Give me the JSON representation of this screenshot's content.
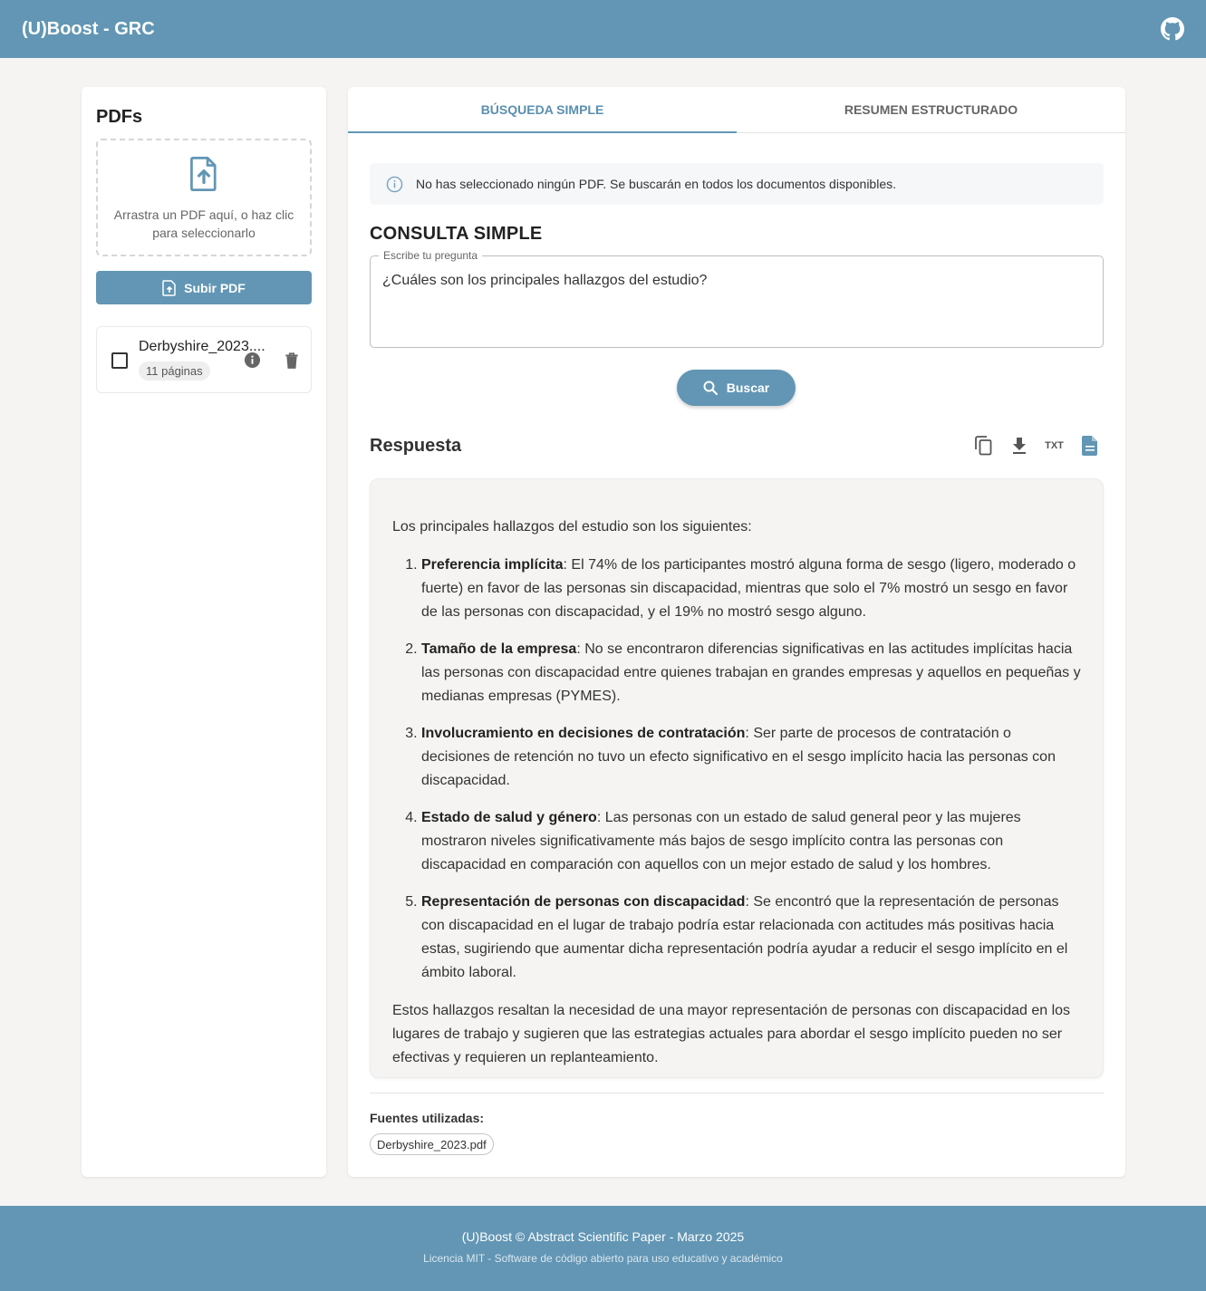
{
  "app": {
    "title": "(U)Boost - GRC",
    "github_icon": "github-icon"
  },
  "sidebar": {
    "title": "PDFs",
    "dropzone_text": "Arrastra un PDF aquí, o haz clic para seleccionarlo",
    "upload_button": "Subir PDF",
    "files": [
      {
        "name": "Derbyshire_2023....",
        "pages": "11 páginas",
        "checked": false
      }
    ]
  },
  "tabs": [
    {
      "label": "BÚSQUEDA SIMPLE",
      "active": true
    },
    {
      "label": "RESUMEN ESTRUCTURADO",
      "active": false
    }
  ],
  "alert": {
    "text": "No has seleccionado ningún PDF. Se buscarán en todos los documentos disponibles."
  },
  "query": {
    "section_title": "CONSULTA SIMPLE",
    "label": "Escribe tu pregunta",
    "value": "¿Cuáles son los principales hallazgos del estudio?"
  },
  "search_button": "Buscar",
  "response": {
    "title": "Respuesta",
    "tools": {
      "copy": "copy-icon",
      "download": "download-icon",
      "txt": "TXT",
      "doc": "document-icon"
    },
    "intro": "Los principales hallazgos del estudio son los siguientes:",
    "items": [
      {
        "title": "Preferencia implícita",
        "text": ": El 74% de los participantes mostró alguna forma de sesgo (ligero, moderado o fuerte) en favor de las personas sin discapacidad, mientras que solo el 7% mostró un sesgo en favor de las personas con discapacidad, y el 19% no mostró sesgo alguno."
      },
      {
        "title": "Tamaño de la empresa",
        "text": ": No se encontraron diferencias significativas en las actitudes implícitas hacia las personas con discapacidad entre quienes trabajan en grandes empresas y aquellos en pequeñas y medianas empresas (PYMES)."
      },
      {
        "title": "Involucramiento en decisiones de contratación",
        "text": ": Ser parte de procesos de contratación o decisiones de retención no tuvo un efecto significativo en el sesgo implícito hacia las personas con discapacidad."
      },
      {
        "title": "Estado de salud y género",
        "text": ": Las personas con un estado de salud general peor y las mujeres mostraron niveles significativamente más bajos de sesgo implícito contra las personas con discapacidad en comparación con aquellos con un mejor estado de salud y los hombres."
      },
      {
        "title": "Representación de personas con discapacidad",
        "text": ": Se encontró que la representación de personas con discapacidad en el lugar de trabajo podría estar relacionada con actitudes más positivas hacia estas, sugiriendo que aumentar dicha representación podría ayudar a reducir el sesgo implícito en el ámbito laboral."
      }
    ],
    "conclusion": "Estos hallazgos resaltan la necesidad de una mayor representación de personas con discapacidad en los lugares de trabajo y sugieren que las estrategias actuales para abordar el sesgo implícito pueden no ser efectivas y requieren un replanteamiento."
  },
  "sources": {
    "label": "Fuentes utilizadas:",
    "items": [
      "Derbyshire_2023.pdf"
    ]
  },
  "footer": {
    "line1": "(U)Boost © Abstract Scientific Paper - Marzo 2025",
    "line2": "Licencia MIT - Software de código abierto para uso educativo y académico"
  },
  "colors": {
    "primary": "#6296b4",
    "background": "#f5f4f2"
  }
}
